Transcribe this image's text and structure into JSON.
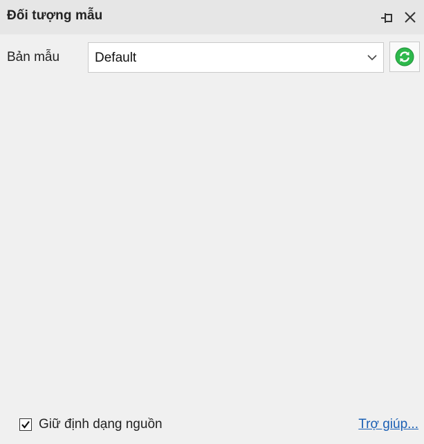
{
  "panel": {
    "title": "Đối tượng mẫu",
    "pin_icon": "pin-icon",
    "close_icon": "close-icon"
  },
  "template": {
    "label": "Bản mẫu",
    "selected": "Default",
    "dropdown_icon": "chevron-down-icon",
    "refresh_icon": "refresh-icon",
    "refresh_color": "#2db84b"
  },
  "footer": {
    "keep_format_label": "Giữ định dạng nguồn",
    "keep_format_checked": true,
    "help_link": "Trợ giúp..."
  }
}
